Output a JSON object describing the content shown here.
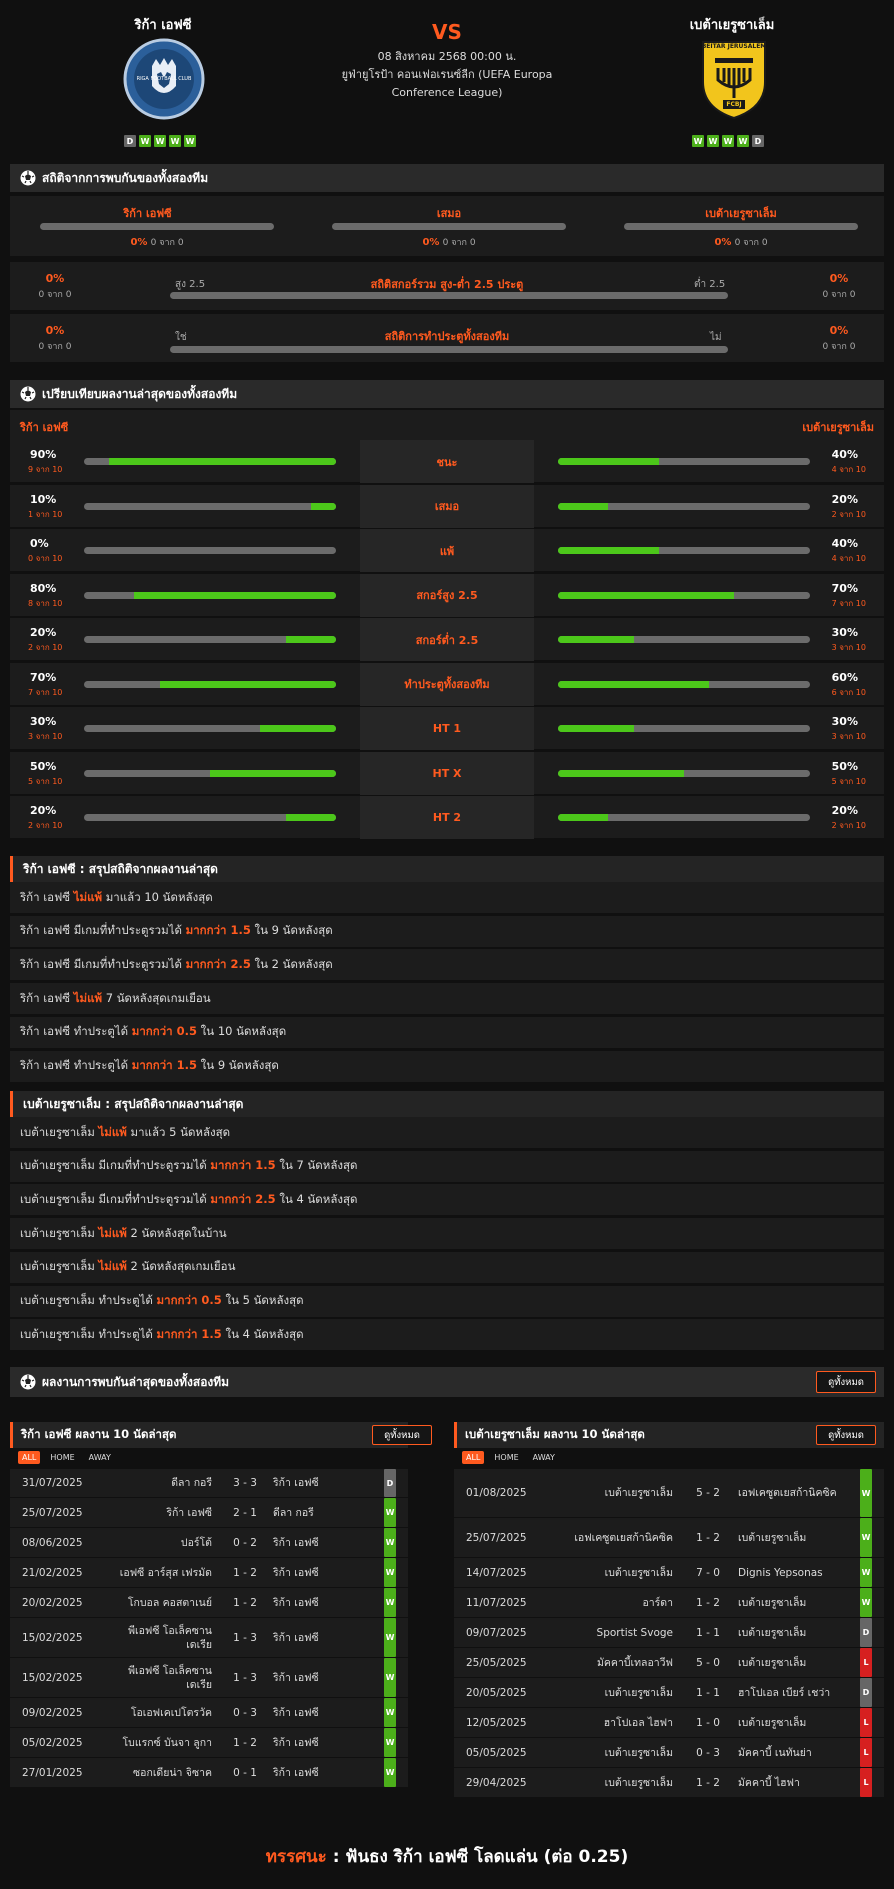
{
  "header": {
    "home_name": "ริก้า เอฟซี",
    "away_name": "เบต้าเยรูซาเล็ม",
    "vs": "VS",
    "date": "08 สิงหาคม 2568 00:00 น.",
    "competition_line1": "ยูฟ่ายูโรป้า คอนเฟอเรนซ์ลีก (UEFA Europa",
    "competition_line2": "Conference League)",
    "home_form": [
      "D",
      "W",
      "W",
      "W",
      "W"
    ],
    "away_form": [
      "W",
      "W",
      "W",
      "W",
      "D"
    ],
    "home_logo_text": "RIGA FOOTBALL CLUB",
    "away_logo_text": "BEITAR JERUSALEM",
    "away_logo_badge": "FCBJ"
  },
  "h2h_stats": {
    "title": "สถิติจากการพบกันของทั้งสองทีม",
    "columns": [
      {
        "label": "ริก้า เอฟซี",
        "pct": "0%",
        "count": "0 จาก 0"
      },
      {
        "label": "เสมอ",
        "pct": "0%",
        "count": "0 จาก 0"
      },
      {
        "label": "เบต้าเยรูซาเล็ม",
        "pct": "0%",
        "count": "0 จาก 0"
      }
    ],
    "over_under": {
      "title": "สถิติสกอร์รวม สูง-ต่ำ 2.5 ประตู",
      "left_label": "สูง 2.5",
      "right_label": "ต่ำ 2.5",
      "left_pct": "0%",
      "left_count": "0 จาก 0",
      "right_pct": "0%",
      "right_count": "0 จาก 0"
    },
    "btts": {
      "title": "สถิติการทำประตูทั้งสองทีม",
      "left_label": "ใช่",
      "right_label": "ไม่",
      "left_pct": "0%",
      "left_count": "0 จาก 0",
      "right_pct": "0%",
      "right_count": "0 จาก 0"
    }
  },
  "comparison": {
    "title": "เปรียบเทียบผลงานล่าสุดของทั้งสองทีม",
    "home_label": "ริก้า เอฟซี",
    "away_label": "เบต้าเยรูซาเล็ม",
    "rows": [
      {
        "label": "ชนะ",
        "home_pct": "90%",
        "home_sub": "9 จาก 10",
        "home_frac": 0.9,
        "away_pct": "40%",
        "away_sub": "4 จาก 10",
        "away_frac": 0.4
      },
      {
        "label": "เสมอ",
        "home_pct": "10%",
        "home_sub": "1 จาก 10",
        "home_frac": 0.1,
        "away_pct": "20%",
        "away_sub": "2 จาก 10",
        "away_frac": 0.2
      },
      {
        "label": "แพ้",
        "home_pct": "0%",
        "home_sub": "0 จาก 10",
        "home_frac": 0,
        "away_pct": "40%",
        "away_sub": "4 จาก 10",
        "away_frac": 0.4
      },
      {
        "label": "สกอร์สูง 2.5",
        "home_pct": "80%",
        "home_sub": "8 จาก 10",
        "home_frac": 0.8,
        "away_pct": "70%",
        "away_sub": "7 จาก 10",
        "away_frac": 0.7
      },
      {
        "label": "สกอร์ต่ำ 2.5",
        "home_pct": "20%",
        "home_sub": "2 จาก 10",
        "home_frac": 0.2,
        "away_pct": "30%",
        "away_sub": "3 จาก 10",
        "away_frac": 0.3
      },
      {
        "label": "ทำประตูทั้งสองทีม",
        "home_pct": "70%",
        "home_sub": "7 จาก 10",
        "home_frac": 0.7,
        "away_pct": "60%",
        "away_sub": "6 จาก 10",
        "away_frac": 0.6
      },
      {
        "label": "HT 1",
        "home_pct": "30%",
        "home_sub": "3 จาก 10",
        "home_frac": 0.3,
        "away_pct": "30%",
        "away_sub": "3 จาก 10",
        "away_frac": 0.3
      },
      {
        "label": "HT X",
        "home_pct": "50%",
        "home_sub": "5 จาก 10",
        "home_frac": 0.5,
        "away_pct": "50%",
        "away_sub": "5 จาก 10",
        "away_frac": 0.5
      },
      {
        "label": "HT 2",
        "home_pct": "20%",
        "home_sub": "2 จาก 10",
        "home_frac": 0.2,
        "away_pct": "20%",
        "away_sub": "2 จาก 10",
        "away_frac": 0.2
      }
    ]
  },
  "home_summary": {
    "title": "ริก้า เอฟซี : สรุปสถิติจากผลงานล่าสุด",
    "rows": [
      {
        "a": "ริก้า เอฟซี ",
        "b": "ไม่แพ้",
        "c": " มาแล้ว 10 นัดหลังสุด"
      },
      {
        "a": "ริก้า เอฟซี มีเกมที่ทำประตูรวมได้ ",
        "b": "มากกว่า 1.5",
        "c": " ใน 9 นัดหลังสุด"
      },
      {
        "a": "ริก้า เอฟซี มีเกมที่ทำประตูรวมได้ ",
        "b": "มากกว่า 2.5",
        "c": " ใน 2 นัดหลังสุด"
      },
      {
        "a": "ริก้า เอฟซี ",
        "b": "ไม่แพ้",
        "c": " 7 นัดหลังสุดเกมเยือน"
      },
      {
        "a": "ริก้า เอฟซี ทำประตูได้ ",
        "b": "มากกว่า 0.5",
        "c": " ใน 10 นัดหลังสุด"
      },
      {
        "a": "ริก้า เอฟซี ทำประตูได้ ",
        "b": "มากกว่า 1.5",
        "c": " ใน 9 นัดหลังสุด"
      }
    ]
  },
  "away_summary": {
    "title": "เบต้าเยรูซาเล็ม : สรุปสถิติจากผลงานล่าสุด",
    "rows": [
      {
        "a": "เบต้าเยรูซาเล็ม ",
        "b": "ไม่แพ้",
        "c": " มาแล้ว 5 นัดหลังสุด"
      },
      {
        "a": "เบต้าเยรูซาเล็ม มีเกมที่ทำประตูรวมได้ ",
        "b": "มากกว่า 1.5",
        "c": " ใน 7 นัดหลังสุด"
      },
      {
        "a": "เบต้าเยรูซาเล็ม มีเกมที่ทำประตูรวมได้ ",
        "b": "มากกว่า 2.5",
        "c": " ใน 4 นัดหลังสุด"
      },
      {
        "a": "เบต้าเยรูซาเล็ม ",
        "b": "ไม่แพ้",
        "c": " 2 นัดหลังสุดในบ้าน"
      },
      {
        "a": "เบต้าเยรูซาเล็ม ",
        "b": "ไม่แพ้",
        "c": " 2 นัดหลังสุดเกมเยือน"
      },
      {
        "a": "เบต้าเยรูซาเล็ม ทำประตูได้ ",
        "b": "มากกว่า 0.5",
        "c": " ใน 5 นัดหลังสุด"
      },
      {
        "a": "เบต้าเยรูซาเล็ม ทำประตูได้ ",
        "b": "มากกว่า 1.5",
        "c": " ใน 4 นัดหลังสุด"
      }
    ]
  },
  "results": {
    "title": "ผลงานการพบกันล่าสุดของทั้งสองทีม",
    "view_all": "ดูทั้งหมด",
    "tabs": [
      "ALL",
      "HOME",
      "AWAY"
    ],
    "home_table": {
      "title": "ริก้า เอฟซี ผลงาน 10 นัดล่าสุด",
      "rows": [
        {
          "date": "31/07/2025",
          "home": "ดีลา กอรี",
          "score": "3 - 3",
          "away": "ริก้า เอฟซี",
          "res": "D"
        },
        {
          "date": "25/07/2025",
          "home": "ริก้า เอฟซี",
          "score": "2 - 1",
          "away": "ดีลา กอรี",
          "res": "W"
        },
        {
          "date": "08/06/2025",
          "home": "ปอร์โต้",
          "score": "0 - 2",
          "away": "ริก้า เอฟซี",
          "res": "W"
        },
        {
          "date": "21/02/2025",
          "home": "เอฟซี อาร์สุส เฟรมัด",
          "score": "1 - 2",
          "away": "ริก้า เอฟซี",
          "res": "W"
        },
        {
          "date": "20/02/2025",
          "home": "โกบอล คอสตาเนย์",
          "score": "1 - 2",
          "away": "ริก้า เอฟซี",
          "res": "W"
        },
        {
          "date": "15/02/2025",
          "home": "พีเอฟซี โอเล็คซานเดเรีย",
          "score": "1 - 3",
          "away": "ริก้า เอฟซี",
          "res": "W"
        },
        {
          "date": "15/02/2025",
          "home": "พีเอฟซี โอเล็คซานเดเรีย",
          "score": "1 - 3",
          "away": "ริก้า เอฟซี",
          "res": "W"
        },
        {
          "date": "09/02/2025",
          "home": "โอเอฟเคเปโตรวัค",
          "score": "0 - 3",
          "away": "ริก้า เอฟซี",
          "res": "W"
        },
        {
          "date": "05/02/2025",
          "home": "โบแรกซ์ บันจา ลูกา",
          "score": "1 - 2",
          "away": "ริก้า เอฟซี",
          "res": "W"
        },
        {
          "date": "27/01/2025",
          "home": "ซอกเดียน่า จิซาค",
          "score": "0 - 1",
          "away": "ริก้า เอฟซี",
          "res": "W"
        }
      ]
    },
    "away_table": {
      "title": "เบต้าเยรูซาเล็ม ผลงาน 10 นัดล่าสุด",
      "rows": [
        {
          "date": "01/08/2025",
          "home": "เบต้าเยรูซาเล็ม",
          "score": "5 - 2",
          "away": "เอฟเคซูตเยสก้านิคซิค",
          "res": "W"
        },
        {
          "date": "25/07/2025",
          "home": "เอฟเคซูตเยสก้านิคซิค",
          "score": "1 - 2",
          "away": "เบต้าเยรูซาเล็ม",
          "res": "W"
        },
        {
          "date": "14/07/2025",
          "home": "เบต้าเยรูซาเล็ม",
          "score": "7 - 0",
          "away": "Dignis Yepsonas",
          "res": "W"
        },
        {
          "date": "11/07/2025",
          "home": "อาร์ดา",
          "score": "1 - 2",
          "away": "เบต้าเยรูซาเล็ม",
          "res": "W"
        },
        {
          "date": "09/07/2025",
          "home": "Sportist Svoge",
          "score": "1 - 1",
          "away": "เบต้าเยรูซาเล็ม",
          "res": "D"
        },
        {
          "date": "25/05/2025",
          "home": "มัคคาบี้เทลอาวีฟ",
          "score": "5 - 0",
          "away": "เบต้าเยรูซาเล็ม",
          "res": "L"
        },
        {
          "date": "20/05/2025",
          "home": "เบต้าเยรูซาเล็ม",
          "score": "1 - 1",
          "away": "ฮาโปเอล เบียร์ เชว่า",
          "res": "D"
        },
        {
          "date": "12/05/2025",
          "home": "ฮาโปเอล ไฮฟา",
          "score": "1 - 0",
          "away": "เบต้าเยรูซาเล็ม",
          "res": "L"
        },
        {
          "date": "05/05/2025",
          "home": "เบต้าเยรูซาเล็ม",
          "score": "0 - 3",
          "away": "มัคคาบี้ เนทันย่า",
          "res": "L"
        },
        {
          "date": "29/04/2025",
          "home": "เบต้าเยรูซาเล็ม",
          "score": "1 - 2",
          "away": "มัคคาบี้ ไฮฟา",
          "res": "L"
        }
      ]
    }
  },
  "footer": {
    "label": "ทรรศนะ",
    "sep": " : ",
    "text": "ฟันธง ริก้า เอฟซี โลดแล่น (ต่อ 0.25)"
  },
  "colors": {
    "accent": "#ff5a1f",
    "win": "#4caf1a",
    "draw": "#666666",
    "loss": "#d62020",
    "bar_fill": "#4cc71a"
  }
}
